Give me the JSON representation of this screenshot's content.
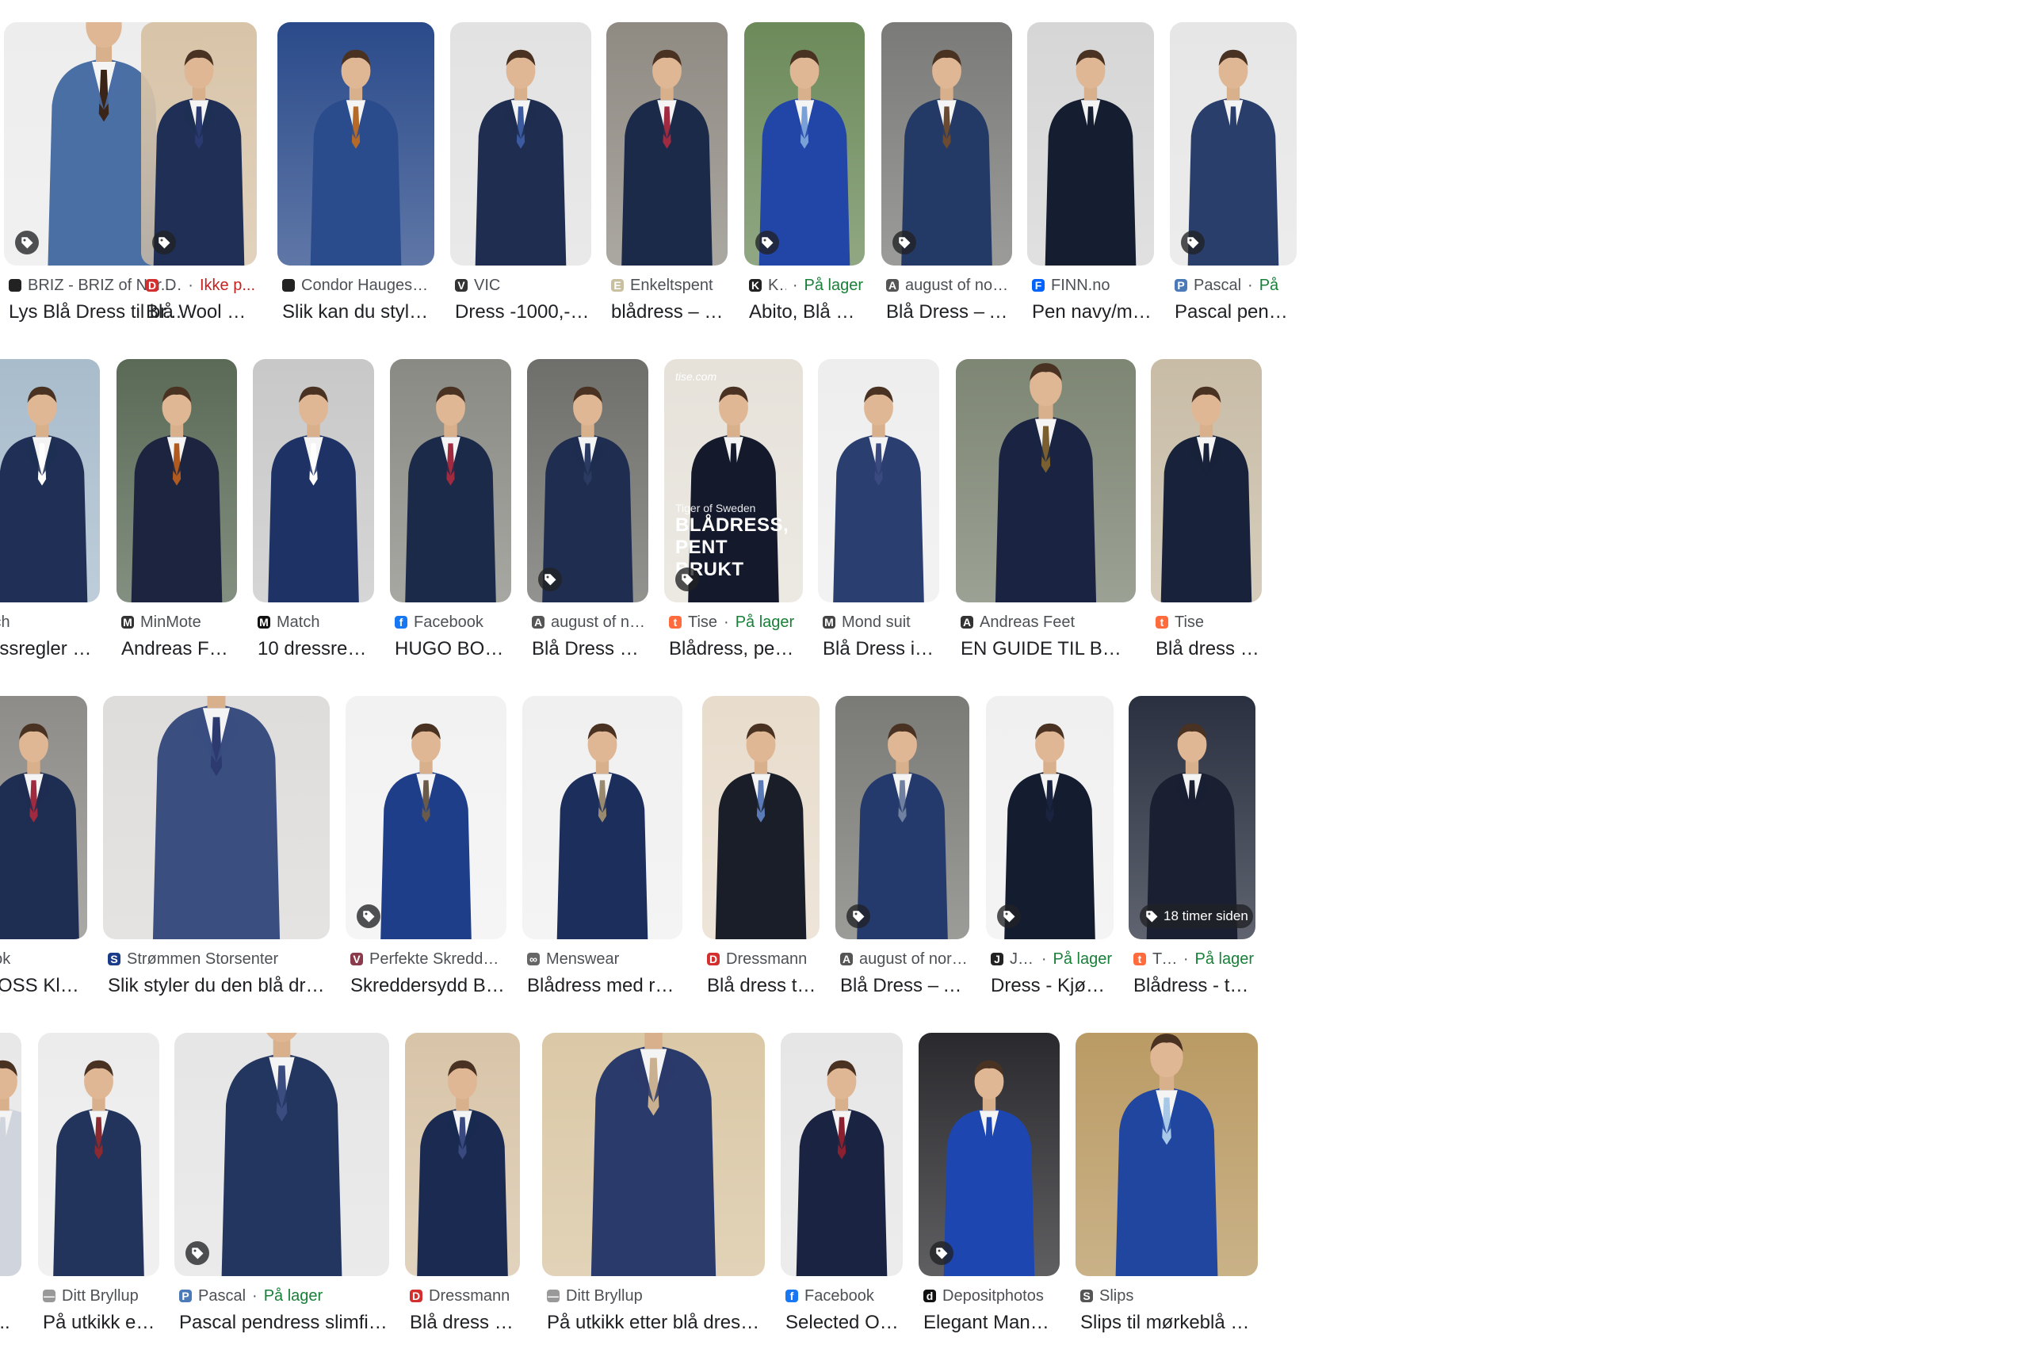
{
  "rows": [
    {
      "cards": [
        {
          "source": "BRIZ - BRIZ of Nor...",
          "stock": "",
          "title": "Lys Blå Dress til br...",
          "bg": "#ececec",
          "suit": "#4a6fa5",
          "tie": "#3a2418",
          "tag": true,
          "tag_text": "",
          "favicon_color": "#222222",
          "favicon_glyph": "tag-favicon"
        },
        {
          "source": "Dressmann",
          "stock": "Ikke p...",
          "stock_state": "out",
          "title": "Blå Wool Stretch d...",
          "bg": "#d8c4a8",
          "suit": "#1f2f55",
          "tie": "#2a3a70",
          "tag": true,
          "tag_text": "",
          "favicon_color": "#d32f2f",
          "favicon_glyph": "D"
        },
        {
          "source": "Condor Haugesund",
          "stock": "",
          "title": "Slik kan du style den blå ...",
          "bg": "#2a4a8a",
          "suit": "#2b4c8c",
          "tie": "#b56a2a",
          "tag": false,
          "tag_text": "",
          "favicon_color": "#222222",
          "favicon_glyph": "flag-favicon"
        },
        {
          "source": "VIC",
          "stock": "",
          "title": "Dress -1000,- | VIC",
          "bg": "#e2e2e2",
          "suit": "#1e2d50",
          "tie": "#3b5aa0",
          "tag": false,
          "tag_text": "",
          "favicon_color": "#333333",
          "favicon_glyph": "V"
        },
        {
          "source": "Enkeltspent",
          "stock": "",
          "title": "blådress – Enkelts...",
          "bg": "#8f8a82",
          "suit": "#1c2a4a",
          "tie": "#a02a40",
          "tag": false,
          "tag_text": "",
          "favicon_color": "#c8c0a0",
          "favicon_glyph": "E"
        },
        {
          "source": "Kleins",
          "stock": "På lager",
          "stock_state": "in",
          "title": "Abito, Blå CC Coll...",
          "bg": "#6c8a5a",
          "suit": "#2246a8",
          "tie": "#7aa0d8",
          "tag": true,
          "tag_text": "",
          "favicon_color": "#222222",
          "favicon_glyph": "K"
        },
        {
          "source": "august of norway",
          "stock": "",
          "title": "Blå Dress – AUGUS...",
          "bg": "#7a7a78",
          "suit": "#243a66",
          "tie": "#6a4a30",
          "tag": true,
          "tag_text": "",
          "favicon_color": "#555555",
          "favicon_glyph": "A"
        },
        {
          "source": "FINN.no",
          "stock": "",
          "title": "Pen navy/mørk blå ...",
          "bg": "#d6d6d6",
          "suit": "#151d30",
          "tie": "#151d30",
          "tag": false,
          "tag_text": "",
          "favicon_color": "#0063fb",
          "favicon_glyph": "F"
        },
        {
          "source": "Pascal",
          "stock": "På",
          "stock_state": "in",
          "title": "Pascal pendre",
          "bg": "#e6e6e6",
          "suit": "#2a3e6c",
          "tie": "#2a3e6c",
          "tag": true,
          "tag_text": "",
          "favicon_color": "#4a7ab8",
          "favicon_glyph": "P"
        }
      ]
    },
    {
      "cards": [
        {
          "source": "tch",
          "stock": "",
          "title": "essregler alle ...",
          "bg": "#a8bccc",
          "suit": "#1f2f55",
          "tie": "#ffffff",
          "tag": false,
          "tag_text": "",
          "favicon_color": "",
          "favicon_glyph": ""
        },
        {
          "source": "MinMote",
          "stock": "",
          "title": "Andreas Feet tipse...",
          "bg": "#5a6a56",
          "suit": "#1c2440",
          "tie": "#b05a20",
          "tag": false,
          "tag_text": "",
          "favicon_color": "#333333",
          "favicon_glyph": "M"
        },
        {
          "source": "Match",
          "stock": "",
          "title": "10 dressregler alle...",
          "bg": "#c8c8c8",
          "suit": "#1e3266",
          "tie": "#ffffff",
          "tag": false,
          "tag_text": "",
          "favicon_color": "#111111",
          "favicon_glyph": "M"
        },
        {
          "source": "Facebook",
          "stock": "",
          "title": "HUGO BOSS Klas...",
          "bg": "#8a8a84",
          "suit": "#1c2a4a",
          "tie": "#a02a40",
          "tag": false,
          "tag_text": "",
          "favicon_color": "#1877f2",
          "favicon_glyph": "f"
        },
        {
          "source": "august of norway",
          "stock": "",
          "title": "Blå Dress – AUGU...",
          "bg": "#6e6e6a",
          "suit": "#1f2d50",
          "tie": "#2a3a60",
          "tag": true,
          "tag_text": "",
          "favicon_color": "#555555",
          "favicon_glyph": "A"
        },
        {
          "source": "Tise",
          "stock": "På lager",
          "stock_state": "in",
          "title": "Blådress, pent brukt • ...",
          "bg": "#e6e2da",
          "suit": "#141a2c",
          "tie": "#141a2c",
          "tag": true,
          "tag_text": "",
          "favicon_color": "#ff6b3d",
          "favicon_glyph": "t",
          "banner": "BLÅDRESS, PENT BRUKT",
          "banner_small": "Tiger of Sweden",
          "banner_brand": "tise.com"
        },
        {
          "source": "Mond suit",
          "stock": "",
          "title": "Blå Dress i Nailhea...",
          "bg": "#eeeeee",
          "suit": "#2a3e70",
          "tie": "#3a4a80",
          "tag": false,
          "tag_text": "",
          "favicon_color": "#444444",
          "favicon_glyph": "M"
        },
        {
          "source": "Andreas Feet",
          "stock": "",
          "title": "EN GUIDE TIL BRYLLUP SO...",
          "bg": "#7a8270",
          "suit": "#1a2442",
          "tie": "#7a6030",
          "tag": false,
          "tag_text": "",
          "favicon_color": "#333333",
          "favicon_glyph": "A"
        },
        {
          "source": "Tise",
          "stock": "",
          "title": "Blå dress til herr",
          "bg": "#c8bca6",
          "suit": "#18223a",
          "tie": "#18223a",
          "tag": false,
          "tag_text": "",
          "favicon_color": "#ff6b3d",
          "favicon_glyph": "t"
        }
      ]
    },
    {
      "cards": [
        {
          "source": "ook",
          "stock": "",
          "title": "BOSS Klassis...",
          "bg": "#8e8c88",
          "suit": "#1e2d52",
          "tie": "#a02a40",
          "tag": false,
          "tag_text": "",
          "favicon_color": "",
          "favicon_glyph": ""
        },
        {
          "source": "Strømmen Storsenter",
          "stock": "",
          "title": "Slik styler du den blå dressen | Ekspert...",
          "bg": "#dcdad8",
          "suit": "#3a4e80",
          "tie": "#2c3a70",
          "tag": false,
          "tag_text": "",
          "favicon_color": "#1a3a8a",
          "favicon_glyph": "S"
        },
        {
          "source": "Perfekte Skreddersydde Dre...",
          "stock": "",
          "title": "Skreddersydd Blå Dress | ...",
          "bg": "#f2f2f2",
          "suit": "#1f3e8a",
          "tie": "#6a5a4a",
          "tag": true,
          "tag_text": "",
          "favicon_color": "#8a3a4a",
          "favicon_glyph": "V"
        },
        {
          "source": "Menswear",
          "stock": "",
          "title": "Blådress med ruter. Mens...",
          "bg": "#f0f0f0",
          "suit": "#1c2f5c",
          "tie": "#9a8a70",
          "tag": false,
          "tag_text": "",
          "favicon_color": "#666666",
          "favicon_glyph": "∞"
        },
        {
          "source": "Dressmann",
          "stock": "",
          "title": "Blå dress til herre ...",
          "bg": "#e8dccc",
          "suit": "#1a1e28",
          "tie": "#5a7ab8",
          "tag": false,
          "tag_text": "",
          "favicon_color": "#d32f2f",
          "favicon_glyph": "D"
        },
        {
          "source": "august of norway",
          "stock": "",
          "title": "Blå Dress – AUGUST...",
          "bg": "#7a7a76",
          "suit": "#243a6c",
          "tie": "#7080a0",
          "tag": true,
          "tag_text": "",
          "favicon_color": "#555555",
          "favicon_glyph": "A"
        },
        {
          "source": "John Henric",
          "stock": "På lager",
          "stock_state": "in",
          "title": "Dress - Kjøp online |...",
          "bg": "#f0f0f0",
          "suit": "#141c30",
          "tie": "#1a2440",
          "tag": true,
          "tag_text": "",
          "favicon_color": "#222222",
          "favicon_glyph": "J"
        },
        {
          "source": "Tise",
          "stock": "På lager",
          "stock_state": "in",
          "title": "Blådress - to bukser",
          "bg": "#2a3040",
          "suit": "#1a2032",
          "tie": "#1a2032",
          "tag": true,
          "tag_text": "18 timer siden",
          "favicon_color": "#ff6b3d",
          "favicon_glyph": "t"
        }
      ]
    },
    {
      "cards": [
        {
          "source": "",
          "stock": "",
          "title": "t...",
          "bg": "#e8e8e8",
          "suit": "#d0d4dc",
          "tie": "#d0d4dc",
          "tag": false,
          "tag_text": "",
          "favicon_color": "",
          "favicon_glyph": ""
        },
        {
          "source": "Ditt Bryllup",
          "stock": "",
          "title": "På utkikk etter blå ...",
          "bg": "#ececec",
          "suit": "#22345c",
          "tie": "#8a2a30",
          "tag": false,
          "tag_text": "",
          "favicon_color": "#999999",
          "favicon_glyph": "—"
        },
        {
          "source": "Pascal",
          "stock": "På lager",
          "stock_state": "in",
          "title": "Pascal pendress slimfit blå 4-19 år | ...",
          "bg": "#e4e4e4",
          "suit": "#233660",
          "tie": "#3a4c80",
          "tag": true,
          "tag_text": "",
          "favicon_color": "#4a7ab8",
          "favicon_glyph": "P"
        },
        {
          "source": "Dressmann",
          "stock": "",
          "title": "Blå dress til herre ...",
          "bg": "#d8c4a8",
          "suit": "#1a2a50",
          "tie": "#3a4a80",
          "tag": false,
          "tag_text": "",
          "favicon_color": "#d32f2f",
          "favicon_glyph": "D"
        },
        {
          "source": "Ditt Bryllup",
          "stock": "",
          "title": "På utkikk etter blå dress til bryllup? Di...",
          "bg": "#d8c4a0",
          "suit": "#2a3a6a",
          "tie": "#c8b090",
          "tag": false,
          "tag_text": "",
          "favicon_color": "#999999",
          "favicon_glyph": "—"
        },
        {
          "source": "Facebook",
          "stock": "",
          "title": "Selected Oasen Be...",
          "bg": "#e6e6e6",
          "suit": "#1a2442",
          "tie": "#8a2030",
          "tag": false,
          "tag_text": "",
          "favicon_color": "#1877f2",
          "favicon_glyph": "f"
        },
        {
          "source": "Depositphotos",
          "stock": "",
          "title": "Elegant Mann Klassisk...",
          "bg": "#2a2a2e",
          "suit": "#1e46b0",
          "tie": "#1e46b0",
          "tag": true,
          "tag_text": "",
          "favicon_color": "#111111",
          "favicon_glyph": "d"
        },
        {
          "source": "Slips",
          "stock": "",
          "title": "Slips til mørkeblå dress",
          "bg": "#b89860",
          "suit": "#2046a0",
          "tie": "#a8c8e8",
          "tag": false,
          "tag_text": "",
          "favicon_color": "#555555",
          "favicon_glyph": "S"
        }
      ]
    }
  ]
}
